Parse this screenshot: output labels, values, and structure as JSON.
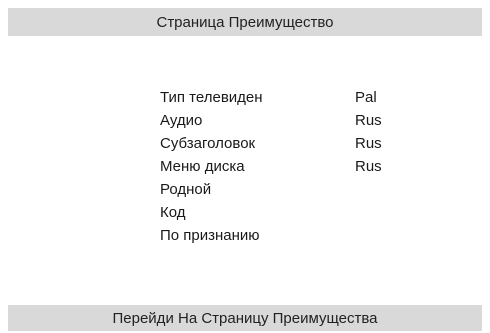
{
  "header": {
    "title": "Страница Преимущество"
  },
  "menu": {
    "items": [
      {
        "label": "Тип телевиден",
        "value": "Pal"
      },
      {
        "label": "Аудио",
        "value": "Rus"
      },
      {
        "label": "Субзаголовок",
        "value": "Rus"
      },
      {
        "label": "Меню диска",
        "value": "Rus"
      },
      {
        "label": "Родной",
        "value": ""
      },
      {
        "label": "Код",
        "value": ""
      },
      {
        "label": "По признанию",
        "value": ""
      }
    ]
  },
  "footer": {
    "text": "Перейди На Страницу Преимущества"
  },
  "colors": {
    "bar_background": "#d9d9d9",
    "screen_background": "#ffffff"
  }
}
